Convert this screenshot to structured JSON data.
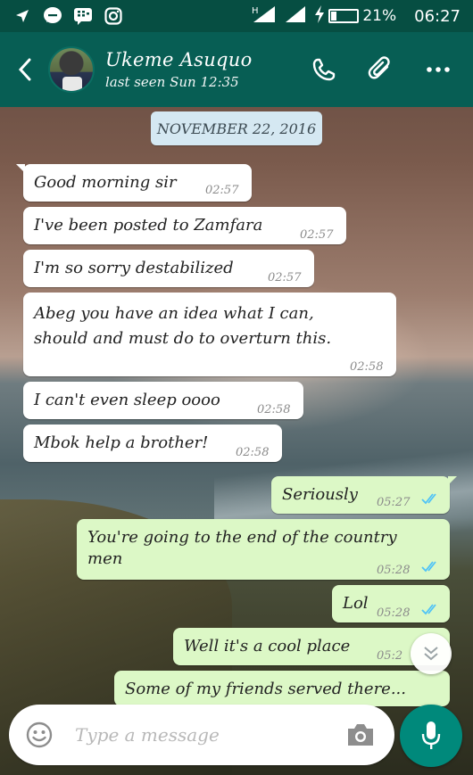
{
  "status_bar": {
    "icons": [
      "location-arrow-icon",
      "messenger-icon",
      "bbm-icon",
      "instagram-icon",
      "h-signal-icon",
      "signal-icon",
      "charging-bolt-icon"
    ],
    "network": "H",
    "battery": "21%",
    "time": "06:27"
  },
  "header": {
    "contact_name": "Ukeme Asuquo",
    "last_seen": "last seen Sun 12:35",
    "actions": [
      "phone-icon",
      "attachment-icon",
      "more-icon"
    ]
  },
  "date_divider": "NOVEMBER 22, 2016",
  "messages": [
    {
      "direction": "in",
      "text_lines": [
        "Good morning sir"
      ],
      "time": "02:57"
    },
    {
      "direction": "in",
      "text_lines": [
        "I've been posted to Zamfara"
      ],
      "time": "02:57"
    },
    {
      "direction": "in",
      "text_lines": [
        "I'm so sorry destabilized"
      ],
      "time": "02:57"
    },
    {
      "direction": "in",
      "text_lines": [
        "Abeg you have an idea what I can,",
        "should and must do to overturn this."
      ],
      "time": "02:58"
    },
    {
      "direction": "in",
      "text_lines": [
        "I can't even sleep oooo"
      ],
      "time": "02:58"
    },
    {
      "direction": "in",
      "text_lines": [
        "Mbok help a brother!"
      ],
      "time": "02:58"
    },
    {
      "direction": "out",
      "text_lines": [
        "Seriously"
      ],
      "time": "05:27",
      "status": "read"
    },
    {
      "direction": "out",
      "text_lines": [
        "You're going to the end of the country",
        "men"
      ],
      "time": "05:28",
      "status": "read"
    },
    {
      "direction": "out",
      "text_lines": [
        "Lol"
      ],
      "time": "05:28",
      "status": "read"
    },
    {
      "direction": "out",
      "text_lines": [
        "Well it's a cool place"
      ],
      "time": "05:2",
      "status": "read"
    },
    {
      "direction": "out",
      "text_lines": [
        "Some of my friends served there..."
      ],
      "time": "",
      "status": ""
    }
  ],
  "composer": {
    "placeholder": "Type a message"
  },
  "colors": {
    "status_bar": "#064e42",
    "app_bar": "#075e54",
    "incoming_bubble": "#ffffff",
    "outgoing_bubble": "#dcf8c6",
    "read_ticks": "#4fc3f7",
    "mic_button": "#00897b"
  }
}
